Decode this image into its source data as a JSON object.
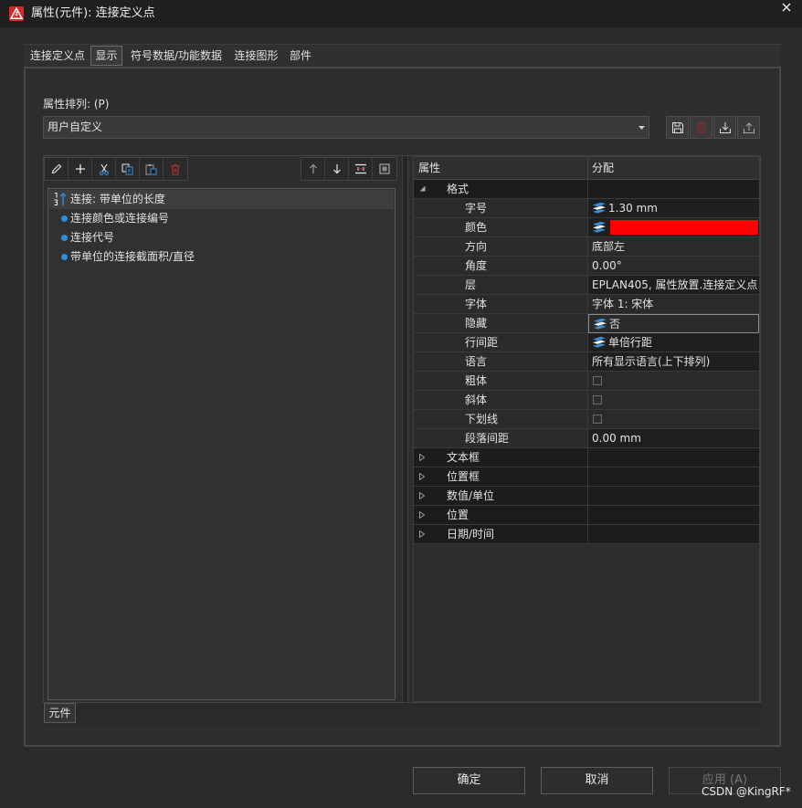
{
  "window": {
    "title": "属性(元件): 连接定义点",
    "app_icon": "eplan-app-icon",
    "close_icon": "close-icon"
  },
  "tabs": [
    {
      "label": "连接定义点",
      "selected": false
    },
    {
      "label": "显示",
      "selected": true
    },
    {
      "label": "符号数据/功能数据",
      "selected": false
    },
    {
      "label": "连接图形",
      "selected": false
    },
    {
      "label": "部件",
      "selected": false
    }
  ],
  "arrangement": {
    "label": "属性排列: (P)",
    "value": "用户自定义",
    "actions": [
      "save-icon",
      "delete-icon",
      "import-icon",
      "export-icon"
    ]
  },
  "list_toolbar": {
    "left": [
      "pencil-icon",
      "plus-icon",
      "scissors-icon",
      "copy-icon",
      "paste-icon",
      "trash-icon"
    ],
    "right": [
      "arrow-up-icon",
      "arrow-down-icon",
      "insert-separator-icon",
      "frame-icon"
    ]
  },
  "list": {
    "items": [
      {
        "label": "连接: 带单位的长度",
        "selected": true,
        "icon": "sort-order-icon"
      },
      {
        "label": "连接颜色或连接编号",
        "selected": false,
        "icon": "bullet-icon"
      },
      {
        "label": "连接代号",
        "selected": false,
        "icon": "bullet-icon"
      },
      {
        "label": "带单位的连接截面积/直径",
        "selected": false,
        "icon": "bullet-icon"
      }
    ]
  },
  "bottom_tab": {
    "label": "元件"
  },
  "grid": {
    "header": {
      "property": "属性",
      "value": "分配"
    },
    "rows": [
      {
        "type": "category",
        "name": "格式",
        "expanded": true
      },
      {
        "type": "property",
        "name": "字号",
        "value": "1.30 mm",
        "icon": "layer-stack-icon"
      },
      {
        "type": "property",
        "name": "颜色",
        "value_color": "#ff0000",
        "icon": "layer-stack-icon"
      },
      {
        "type": "property",
        "name": "方向",
        "value": "底部左"
      },
      {
        "type": "property",
        "name": "角度",
        "value": "0.00°"
      },
      {
        "type": "property",
        "name": "层",
        "value": "EPLAN405, 属性放置.连接定义点"
      },
      {
        "type": "property",
        "name": "字体",
        "value": "字体 1: 宋体"
      },
      {
        "type": "property",
        "name": "隐藏",
        "value": "否",
        "icon": "layer-stack-icon"
      },
      {
        "type": "property",
        "name": "行间距",
        "value": "单倍行距",
        "icon": "layer-stack-icon"
      },
      {
        "type": "property",
        "name": "语言",
        "value": "所有显示语言(上下排列)"
      },
      {
        "type": "property",
        "name": "粗体",
        "checked": false
      },
      {
        "type": "property",
        "name": "斜体",
        "checked": false
      },
      {
        "type": "property",
        "name": "下划线",
        "checked": false
      },
      {
        "type": "property",
        "name": "段落间距",
        "value": "0.00 mm"
      },
      {
        "type": "category",
        "name": "文本框",
        "expanded": false
      },
      {
        "type": "category",
        "name": "位置框",
        "expanded": false
      },
      {
        "type": "category",
        "name": "数值/单位",
        "expanded": false
      },
      {
        "type": "category",
        "name": "位置",
        "expanded": false
      },
      {
        "type": "category",
        "name": "日期/时间",
        "expanded": false
      }
    ]
  },
  "buttons": {
    "ok": "确定",
    "cancel": "取消",
    "apply": "应用 (A)",
    "apply_enabled": false
  },
  "watermark": "CSDN @KingRF*",
  "colors": {
    "accent_blue": "#2c8fdc",
    "delete_red": "#b33232",
    "app_icon_red": "#d42a2a"
  }
}
